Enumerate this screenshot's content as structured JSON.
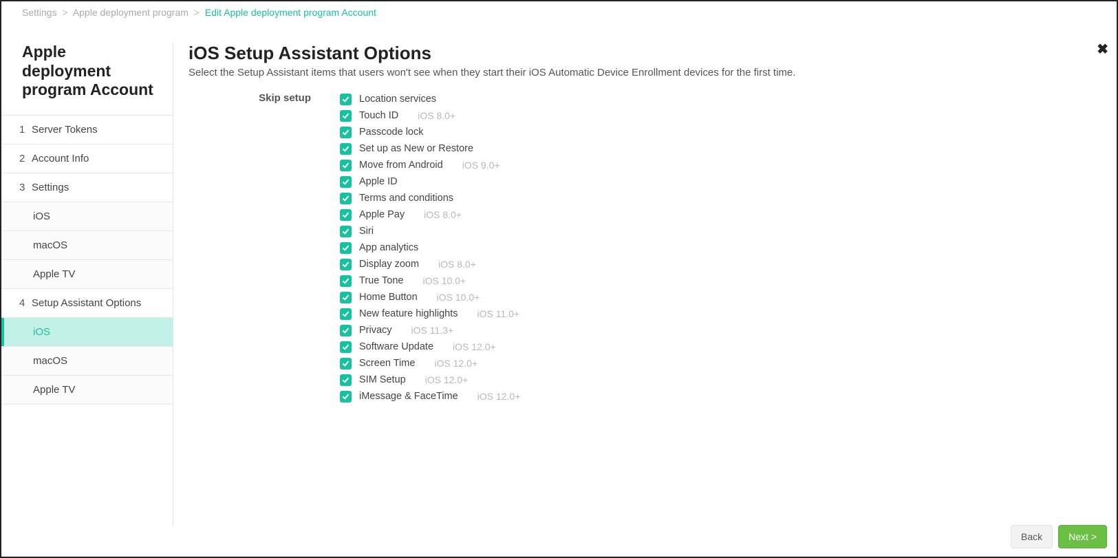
{
  "breadcrumb": {
    "l1": "Settings",
    "l2": "Apple deployment program",
    "l3": "Edit Apple deployment program Account"
  },
  "sidebar": {
    "title": "Apple deployment program Account",
    "items": [
      {
        "num": "1",
        "label": "Server Tokens"
      },
      {
        "num": "2",
        "label": "Account Info"
      },
      {
        "num": "3",
        "label": "Settings"
      }
    ],
    "settings_children": [
      {
        "label": "iOS"
      },
      {
        "label": "macOS"
      },
      {
        "label": "Apple TV"
      }
    ],
    "item4": {
      "num": "4",
      "label": "Setup Assistant Options"
    },
    "setup_children": [
      {
        "label": "iOS",
        "active": true
      },
      {
        "label": "macOS"
      },
      {
        "label": "Apple TV"
      }
    ]
  },
  "main": {
    "title": "iOS Setup Assistant Options",
    "description": "Select the Setup Assistant items that users won't see when they start their iOS Automatic Device Enrollment devices for the first time.",
    "form_label": "Skip setup",
    "options": [
      {
        "label": "Location services",
        "note": ""
      },
      {
        "label": "Touch ID",
        "note": "iOS 8.0+"
      },
      {
        "label": "Passcode lock",
        "note": ""
      },
      {
        "label": "Set up as New or Restore",
        "note": ""
      },
      {
        "label": "Move from Android",
        "note": "iOS 9.0+"
      },
      {
        "label": "Apple ID",
        "note": ""
      },
      {
        "label": "Terms and conditions",
        "note": ""
      },
      {
        "label": "Apple Pay",
        "note": "iOS 8.0+"
      },
      {
        "label": "Siri",
        "note": ""
      },
      {
        "label": "App analytics",
        "note": ""
      },
      {
        "label": "Display zoom",
        "note": "iOS 8.0+"
      },
      {
        "label": "True Tone",
        "note": "iOS 10.0+"
      },
      {
        "label": "Home Button",
        "note": "iOS 10.0+"
      },
      {
        "label": "New feature highlights",
        "note": "iOS 11.0+"
      },
      {
        "label": "Privacy",
        "note": "iOS 11.3+"
      },
      {
        "label": "Software Update",
        "note": "iOS 12.0+"
      },
      {
        "label": "Screen Time",
        "note": "iOS 12.0+"
      },
      {
        "label": "SIM Setup",
        "note": "iOS 12.0+"
      },
      {
        "label": "iMessage & FaceTime",
        "note": "iOS 12.0+"
      }
    ]
  },
  "footer": {
    "back": "Back",
    "next": "Next >"
  }
}
